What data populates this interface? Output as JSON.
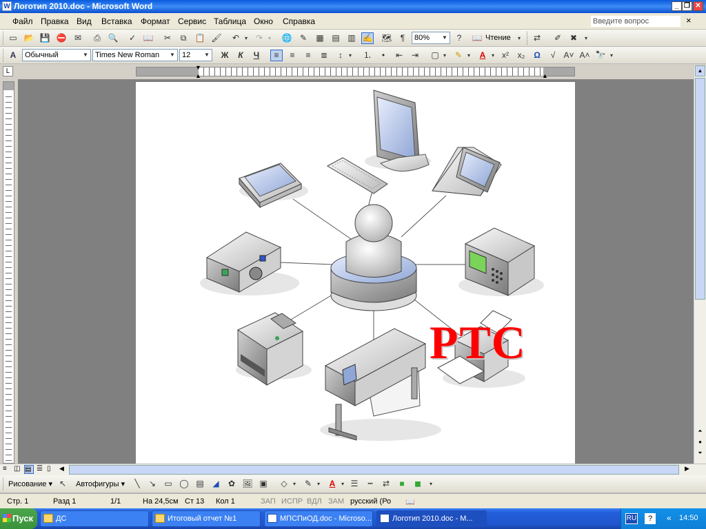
{
  "window": {
    "title": "Логотип 2010.doc - Microsoft Word",
    "app_icon": "W"
  },
  "menu": {
    "items": [
      "Файл",
      "Правка",
      "Вид",
      "Вставка",
      "Формат",
      "Сервис",
      "Таблица",
      "Окно",
      "Справка"
    ],
    "ask_placeholder": "Введите вопрос",
    "close": "×"
  },
  "toolbar1": {
    "zoom": "80%",
    "reading": "Чтение"
  },
  "toolbar2": {
    "style": "Обычный",
    "font": "Times New Roman",
    "size": "12",
    "bold": "Ж",
    "italic": "К",
    "underline": "Ч",
    "font_color_label": "A",
    "omega": "Ω"
  },
  "ruler": {
    "tab_selector": "L"
  },
  "document": {
    "logo_text": "РТС"
  },
  "drawing": {
    "draw_label": "Рисование",
    "autoshapes_label": "Автофигуры"
  },
  "status": {
    "page": "Стр.  1",
    "section": "Разд  1",
    "pages": "1/1",
    "position": "На 24,5см",
    "line": "Ст  13",
    "column": "Кол  1",
    "rec": "ЗАП",
    "trk": "ИСПР",
    "ext": "ВДЛ",
    "ovr": "ЗАМ",
    "language": "русский (Ро"
  },
  "taskbar": {
    "start": "Пуск",
    "tasks": [
      "ДС",
      "Итоговый отчет №1",
      "МПСПиОД.doc - Microso...",
      "Логотип 2010.doc - M..."
    ],
    "lang": "RU",
    "time": "14:50"
  }
}
